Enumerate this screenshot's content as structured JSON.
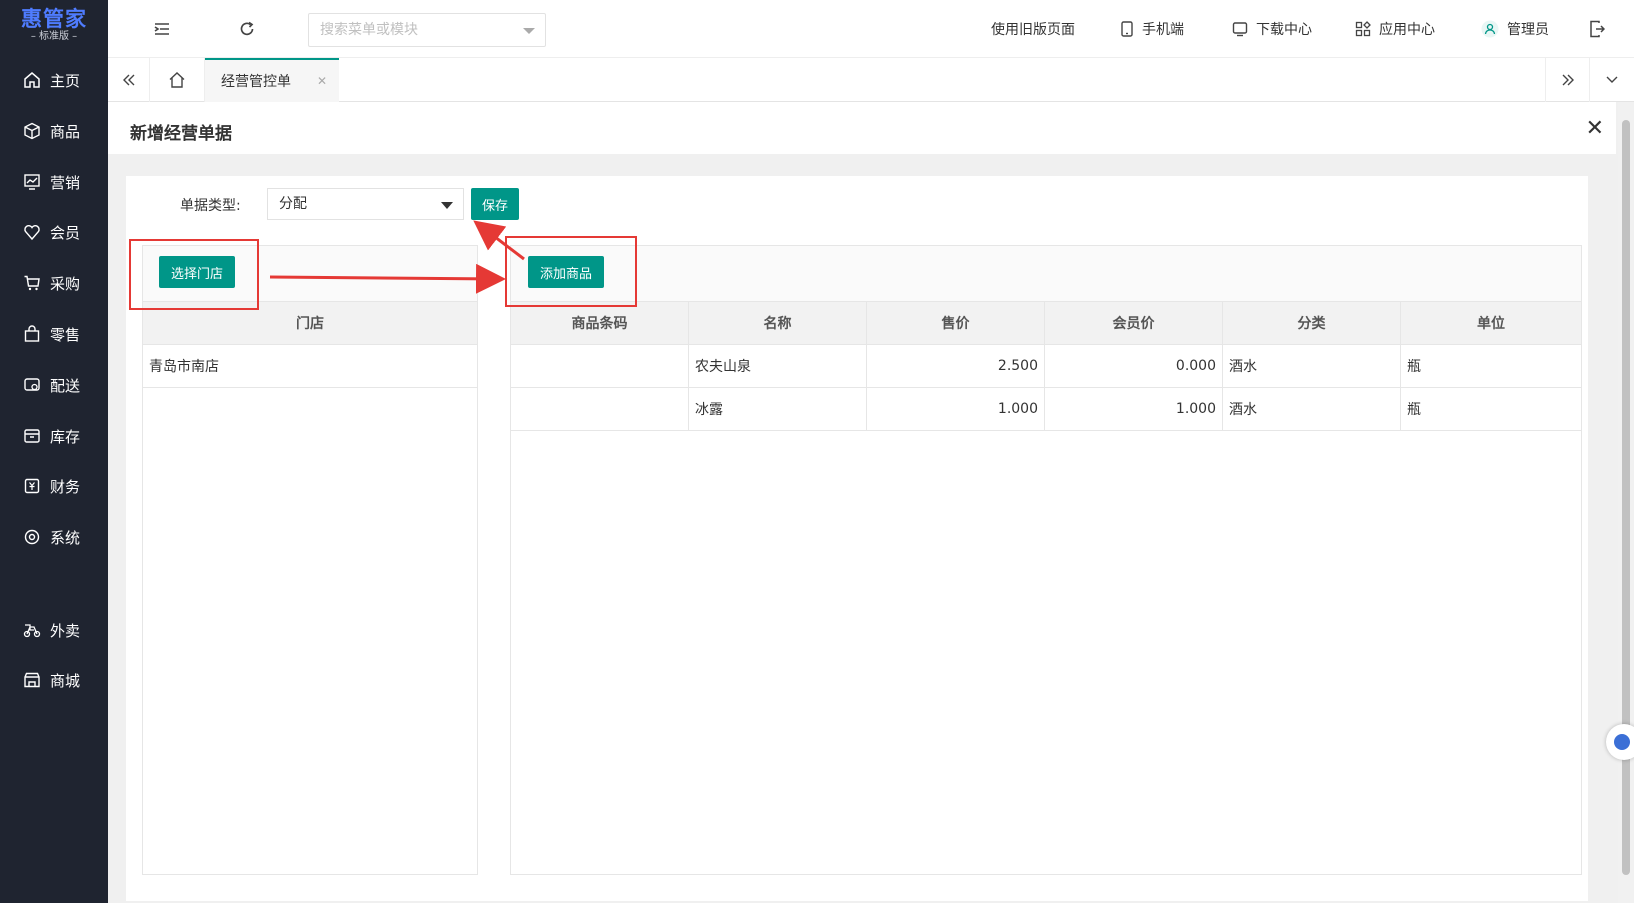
{
  "brand": {
    "name": "惠管家",
    "edition": "– 标准版 –"
  },
  "sidebar": {
    "items": [
      {
        "label": "主页",
        "icon": "home-icon"
      },
      {
        "label": "商品",
        "icon": "cube-icon"
      },
      {
        "label": "营销",
        "icon": "chart-icon"
      },
      {
        "label": "会员",
        "icon": "heart-icon"
      },
      {
        "label": "采购",
        "icon": "cart-icon"
      },
      {
        "label": "零售",
        "icon": "bag-icon"
      },
      {
        "label": "配送",
        "icon": "delivery-icon"
      },
      {
        "label": "库存",
        "icon": "box-icon"
      },
      {
        "label": "财务",
        "icon": "yen-icon"
      },
      {
        "label": "系统",
        "icon": "settings-icon"
      },
      {
        "label": "外卖",
        "icon": "bike-icon"
      },
      {
        "label": "商城",
        "icon": "shop-icon"
      }
    ]
  },
  "topbar": {
    "search_placeholder": "搜索菜单或模块",
    "links": {
      "old_version": "使用旧版页面",
      "mobile": "手机端",
      "download": "下载中心",
      "apps": "应用中心",
      "user": "管理员"
    }
  },
  "tabs": {
    "active": "经营管控单"
  },
  "panel": {
    "title": "新增经营单据"
  },
  "form": {
    "type_label": "单据类型:",
    "type_value": "分配",
    "save_label": "保存"
  },
  "stores": {
    "select_button": "选择门店",
    "header": "门店",
    "rows": [
      "青岛市南店"
    ]
  },
  "goods": {
    "add_button": "添加商品",
    "headers": [
      "商品条码",
      "名称",
      "售价",
      "会员价",
      "分类",
      "单位"
    ],
    "rows": [
      {
        "barcode": "",
        "name": "农夫山泉",
        "price": "2.500",
        "member_price": "0.000",
        "category": "酒水",
        "unit": "瓶"
      },
      {
        "barcode": "",
        "name": "冰露",
        "price": "1.000",
        "member_price": "1.000",
        "category": "酒水",
        "unit": "瓶"
      }
    ]
  },
  "colors": {
    "primary": "#009688",
    "sidebar": "#1f2430",
    "annotation": "#e53935",
    "brand": "#4f7cff"
  }
}
